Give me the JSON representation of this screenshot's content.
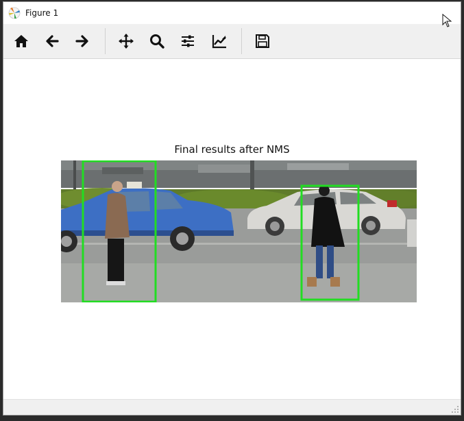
{
  "window": {
    "title": "Figure 1"
  },
  "toolbar": {
    "buttons": [
      {
        "id": "home",
        "icon": "home-icon"
      },
      {
        "id": "back",
        "icon": "arrow-left-icon"
      },
      {
        "id": "forward",
        "icon": "arrow-right-icon"
      },
      {
        "id": "pan",
        "icon": "move-icon"
      },
      {
        "id": "zoom",
        "icon": "magnifier-icon"
      },
      {
        "id": "configure",
        "icon": "sliders-icon"
      },
      {
        "id": "edit-axes",
        "icon": "chart-line-icon"
      },
      {
        "id": "save",
        "icon": "floppy-disk-icon"
      }
    ]
  },
  "figure": {
    "title": "Final results after NMS",
    "box_color": "#22dd22"
  }
}
